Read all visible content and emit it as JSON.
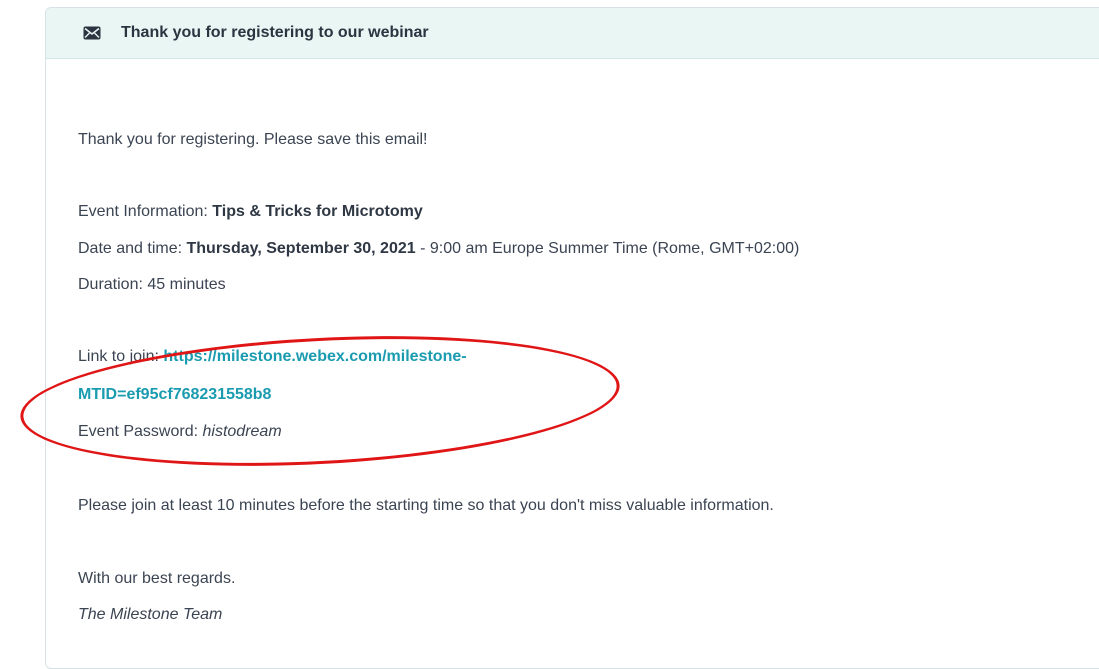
{
  "header": {
    "title": "Thank you for registering to our webinar",
    "icon": "envelope-icon"
  },
  "body": {
    "greeting": "Thank you for registering. Please save this email!",
    "event_info_label": "Event Information: ",
    "event_info_value": "Tips & Tricks for Microtomy",
    "date_label": "Date and time: ",
    "date_value": "Thursday, September 30, 2021",
    "date_rest": " - 9:00 am Europe Summer Time (Rome, GMT+02:00)",
    "duration": "Duration: 45 minutes",
    "link_label": "Link to join: ",
    "link_line1": "https://milestone.webex.com/milestone-",
    "link_line2": "MTID=ef95cf768231558b8",
    "password_label": "Event Password: ",
    "password_value": "histodream",
    "advice": "Please join at least 10 minutes before the starting time so that you don't miss valuable information.",
    "regards": "With our best regards.",
    "signature": "The Milestone Team"
  },
  "colors": {
    "annotation": "#e01515",
    "link": "#1a9bb0",
    "header_bg": "#e9f6f4"
  }
}
